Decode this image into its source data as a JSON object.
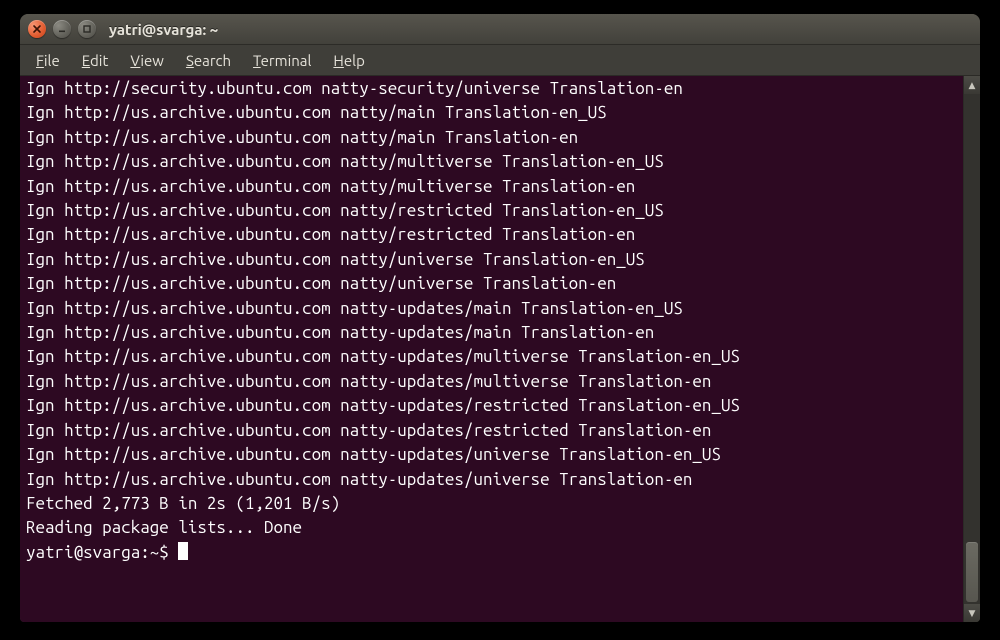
{
  "window": {
    "title": "yatri@svarga: ~"
  },
  "menubar": {
    "items": [
      "File",
      "Edit",
      "View",
      "Search",
      "Terminal",
      "Help"
    ]
  },
  "terminal": {
    "lines": [
      "Ign http://security.ubuntu.com natty-security/universe Translation-en",
      "Ign http://us.archive.ubuntu.com natty/main Translation-en_US",
      "Ign http://us.archive.ubuntu.com natty/main Translation-en",
      "Ign http://us.archive.ubuntu.com natty/multiverse Translation-en_US",
      "Ign http://us.archive.ubuntu.com natty/multiverse Translation-en",
      "Ign http://us.archive.ubuntu.com natty/restricted Translation-en_US",
      "Ign http://us.archive.ubuntu.com natty/restricted Translation-en",
      "Ign http://us.archive.ubuntu.com natty/universe Translation-en_US",
      "Ign http://us.archive.ubuntu.com natty/universe Translation-en",
      "Ign http://us.archive.ubuntu.com natty-updates/main Translation-en_US",
      "Ign http://us.archive.ubuntu.com natty-updates/main Translation-en",
      "Ign http://us.archive.ubuntu.com natty-updates/multiverse Translation-en_US",
      "Ign http://us.archive.ubuntu.com natty-updates/multiverse Translation-en",
      "Ign http://us.archive.ubuntu.com natty-updates/restricted Translation-en_US",
      "Ign http://us.archive.ubuntu.com natty-updates/restricted Translation-en",
      "Ign http://us.archive.ubuntu.com natty-updates/universe Translation-en_US",
      "Ign http://us.archive.ubuntu.com natty-updates/universe Translation-en",
      "Fetched 2,773 B in 2s (1,201 B/s)",
      "Reading package lists... Done"
    ],
    "prompt": "yatri@svarga:~$ "
  }
}
